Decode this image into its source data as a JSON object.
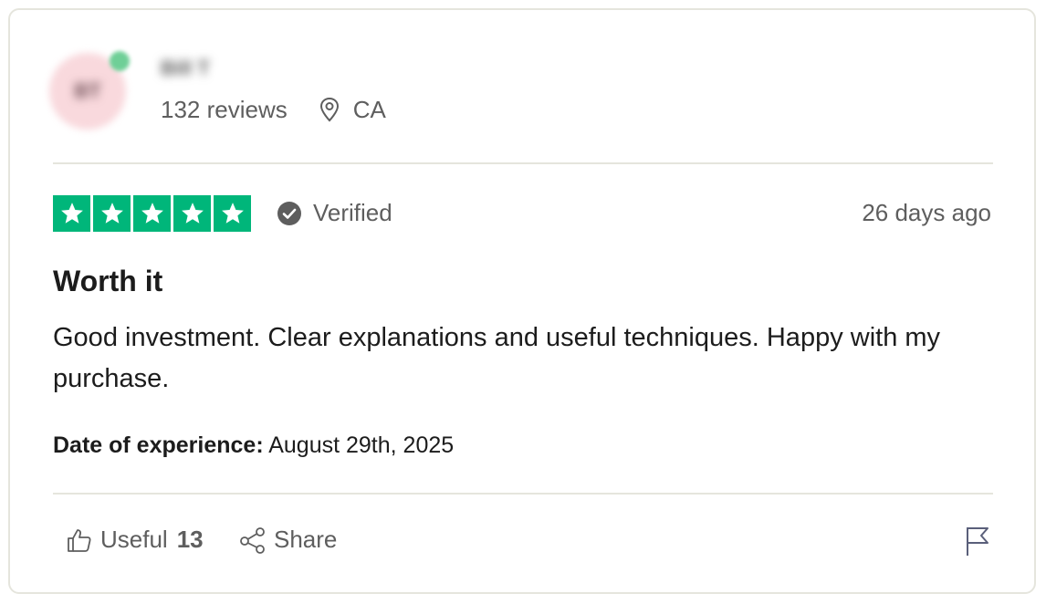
{
  "reviewer": {
    "name": "Bill T",
    "initials": "BT",
    "reviews_count": "132 reviews",
    "location": "CA"
  },
  "rating": {
    "stars": 5,
    "max_stars": 5,
    "verified_label": "Verified",
    "date_ago": "26 days ago"
  },
  "review": {
    "title": "Worth it",
    "body": "Good investment. Clear explanations and useful techniques. Happy with my purchase.",
    "experience_label": "Date of experience:",
    "experience_date": "August 29th, 2025"
  },
  "actions": {
    "useful_label": "Useful",
    "useful_count": "13",
    "share_label": "Share"
  },
  "colors": {
    "star_green": "#00b67a",
    "text_muted": "#5e5e5e",
    "border": "#e5e5dd"
  },
  "icons": [
    "location-pin-icon",
    "verified-check-icon",
    "star-icon",
    "thumbs-up-icon",
    "share-icon",
    "flag-icon"
  ]
}
